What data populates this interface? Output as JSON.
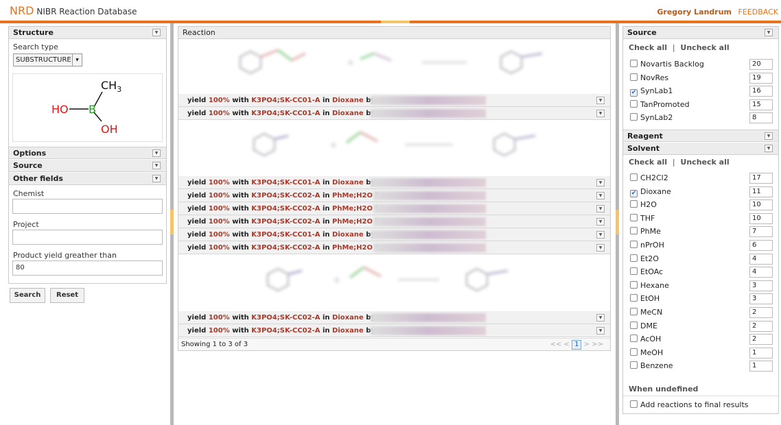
{
  "header": {
    "logo": "NRD",
    "app_title": "NIBR Reaction Database",
    "user": "Gregory Landrum",
    "feedback": "FEEDBACK"
  },
  "left": {
    "structure_header": "Structure",
    "search_type_label": "Search type",
    "search_type_value": "SUBSTRUCTURE",
    "molecule": {
      "ch3": "CH",
      "ch3_sub": "3",
      "ho": "HO",
      "b": "B",
      "oh": "OH"
    },
    "options_header": "Options",
    "source_header": "Source",
    "other_fields_header": "Other fields",
    "chemist_label": "Chemist",
    "chemist_value": "",
    "project_label": "Project",
    "project_value": "",
    "yield_label": "Product yield greather than",
    "yield_value": "80",
    "search_button": "Search",
    "reset_button": "Reset"
  },
  "center": {
    "reaction_header": "Reaction",
    "rows": [
      {
        "yield": "yield",
        "pct": "100%",
        "with": "with",
        "reagent": "K3PO4;SK-CC01-A",
        "in": "in",
        "solvent": "Dioxane",
        "by": "by"
      },
      {
        "yield": "yield",
        "pct": "100%",
        "with": "with",
        "reagent": "K3PO4;SK-CC01-A",
        "in": "in",
        "solvent": "Dioxane",
        "by": "by"
      },
      {
        "yield": "yield",
        "pct": "100%",
        "with": "with",
        "reagent": "K3PO4;SK-CC01-A",
        "in": "in",
        "solvent": "Dioxane",
        "by": "by"
      },
      {
        "yield": "yield",
        "pct": "100%",
        "with": "with",
        "reagent": "K3PO4;SK-CC02-A",
        "in": "in",
        "solvent": "PhMe;H2O",
        "by": "b"
      },
      {
        "yield": "yield",
        "pct": "100%",
        "with": "with",
        "reagent": "K3PO4;SK-CC02-A",
        "in": "in",
        "solvent": "PhMe;H2O",
        "by": "b"
      },
      {
        "yield": "yield",
        "pct": "100%",
        "with": "with",
        "reagent": "K3PO4;SK-CC02-A",
        "in": "in",
        "solvent": "PhMe;H2O",
        "by": "b"
      },
      {
        "yield": "yield",
        "pct": "100%",
        "with": "with",
        "reagent": "K3PO4;SK-CC01-A",
        "in": "in",
        "solvent": "Dioxane",
        "by": "by"
      },
      {
        "yield": "yield",
        "pct": "100%",
        "with": "with",
        "reagent": "K3PO4;SK-CC02-A",
        "in": "in",
        "solvent": "PhMe;H2O",
        "by": "b"
      },
      {
        "yield": "yield",
        "pct": "100%",
        "with": "with",
        "reagent": "K3PO4;SK-CC02-A",
        "in": "in",
        "solvent": "Dioxane",
        "by": "by"
      },
      {
        "yield": "yield",
        "pct": "100%",
        "with": "with",
        "reagent": "K3PO4;SK-CC02-A",
        "in": "in",
        "solvent": "Dioxane",
        "by": "by"
      }
    ],
    "pager_text": "Showing 1 to 3 of 3",
    "pager_first": "<<",
    "pager_prev": "<",
    "pager_page": "1",
    "pager_next": ">",
    "pager_last": ">>"
  },
  "right": {
    "source_header": "Source",
    "check_all": "Check all",
    "sep": "|",
    "uncheck_all": "Uncheck all",
    "sources": [
      {
        "label": "Novartis Backlog",
        "count": "20",
        "checked": false
      },
      {
        "label": "NovRes",
        "count": "19",
        "checked": false
      },
      {
        "label": "SynLab1",
        "count": "16",
        "checked": true
      },
      {
        "label": "TanPromoted",
        "count": "15",
        "checked": false
      },
      {
        "label": "SynLab2",
        "count": "8",
        "checked": false
      }
    ],
    "reagent_header": "Reagent",
    "solvent_header": "Solvent",
    "solvents": [
      {
        "label": "CH2Cl2",
        "count": "17",
        "checked": false
      },
      {
        "label": "Dioxane",
        "count": "11",
        "checked": true
      },
      {
        "label": "H2O",
        "count": "10",
        "checked": false
      },
      {
        "label": "THF",
        "count": "10",
        "checked": false
      },
      {
        "label": "PhMe",
        "count": "7",
        "checked": false
      },
      {
        "label": "nPrOH",
        "count": "6",
        "checked": false
      },
      {
        "label": "Et2O",
        "count": "4",
        "checked": false
      },
      {
        "label": "EtOAc",
        "count": "4",
        "checked": false
      },
      {
        "label": "Hexane",
        "count": "3",
        "checked": false
      },
      {
        "label": "EtOH",
        "count": "3",
        "checked": false
      },
      {
        "label": "MeCN",
        "count": "2",
        "checked": false
      },
      {
        "label": "DME",
        "count": "2",
        "checked": false
      },
      {
        "label": "AcOH",
        "count": "2",
        "checked": false
      },
      {
        "label": "MeOH",
        "count": "1",
        "checked": false
      },
      {
        "label": "Benzene",
        "count": "1",
        "checked": false
      }
    ],
    "when_undefined": "When undefined",
    "add_reactions": "Add reactions to final results"
  }
}
